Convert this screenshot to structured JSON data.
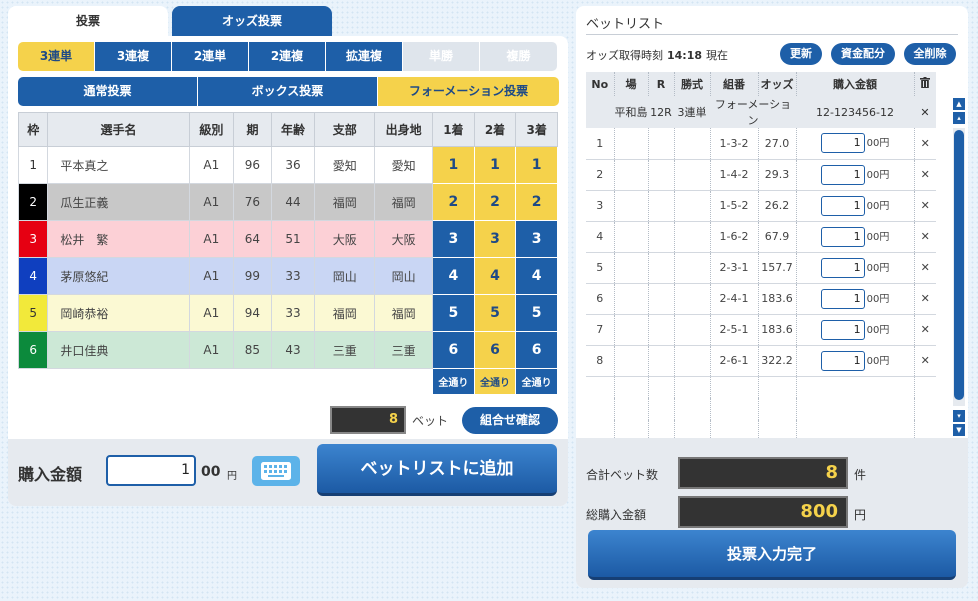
{
  "tabs": {
    "vote": "投票",
    "odds": "オッズ投票"
  },
  "bet_types": [
    {
      "label": "3連単",
      "state": "sel"
    },
    {
      "label": "3連複",
      "state": ""
    },
    {
      "label": "2連単",
      "state": ""
    },
    {
      "label": "2連複",
      "state": ""
    },
    {
      "label": "拡連複",
      "state": ""
    },
    {
      "label": "単勝",
      "state": "dis"
    },
    {
      "label": "複勝",
      "state": "dis"
    }
  ],
  "vote_modes": [
    {
      "label": "通常投票",
      "state": ""
    },
    {
      "label": "ボックス投票",
      "state": ""
    },
    {
      "label": "フォーメーション投票",
      "state": "sel"
    }
  ],
  "racer_table": {
    "headers": [
      "枠",
      "選手名",
      "級別",
      "期",
      "年齢",
      "支部",
      "出身地",
      "1着",
      "2着",
      "3着"
    ],
    "rows": [
      {
        "frame": "1",
        "name": "平本真之",
        "cls": "A1",
        "term": "96",
        "age": "36",
        "branch": "愛知",
        "birth": "愛知",
        "p1": "1",
        "p2": "1",
        "p3": "1",
        "s1": true,
        "s2": true,
        "s3": true
      },
      {
        "frame": "2",
        "name": "瓜生正義",
        "cls": "A1",
        "term": "76",
        "age": "44",
        "branch": "福岡",
        "birth": "福岡",
        "p1": "2",
        "p2": "2",
        "p3": "2",
        "s1": true,
        "s2": true,
        "s3": true
      },
      {
        "frame": "3",
        "name": "松井　繁",
        "cls": "A1",
        "term": "64",
        "age": "51",
        "branch": "大阪",
        "birth": "大阪",
        "p1": "3",
        "p2": "3",
        "p3": "3",
        "s1": false,
        "s2": true,
        "s3": false
      },
      {
        "frame": "4",
        "name": "茅原悠紀",
        "cls": "A1",
        "term": "99",
        "age": "33",
        "branch": "岡山",
        "birth": "岡山",
        "p1": "4",
        "p2": "4",
        "p3": "4",
        "s1": false,
        "s2": true,
        "s3": false
      },
      {
        "frame": "5",
        "name": "岡崎恭裕",
        "cls": "A1",
        "term": "94",
        "age": "33",
        "branch": "福岡",
        "birth": "福岡",
        "p1": "5",
        "p2": "5",
        "p3": "5",
        "s1": false,
        "s2": true,
        "s3": false
      },
      {
        "frame": "6",
        "name": "井口佳典",
        "cls": "A1",
        "term": "85",
        "age": "43",
        "branch": "三重",
        "birth": "三重",
        "p1": "6",
        "p2": "6",
        "p3": "6",
        "s1": false,
        "s2": true,
        "s3": false
      }
    ],
    "all_label": "全通り",
    "all_sel": [
      false,
      true,
      false
    ]
  },
  "bet_count": "8",
  "bet_unit": "ベット",
  "confirm_label": "組合せ確認",
  "purchase": {
    "label": "購入金額",
    "value": "1",
    "unit": "00",
    "yen": "円",
    "add_label": "ベットリストに追加"
  },
  "betlist": {
    "title": "ベットリスト",
    "odds_label": "オッズ取得時刻",
    "odds_time": "14:18",
    "odds_now": "現在",
    "update_label": "更新",
    "fund_label": "資金配分",
    "delete_all_label": "全削除",
    "headers": [
      "No",
      "場",
      "R",
      "勝式",
      "組番",
      "オッズ",
      "購入金額"
    ],
    "group": {
      "venue": "平和島",
      "race": "12R",
      "type": "3連単",
      "combo": "フォーメーション",
      "amount": "12-123456-12"
    },
    "rows": [
      {
        "no": "1",
        "combo": "1-3-2",
        "odds": "27.0",
        "amount": "1"
      },
      {
        "no": "2",
        "combo": "1-4-2",
        "odds": "29.3",
        "amount": "1"
      },
      {
        "no": "3",
        "combo": "1-5-2",
        "odds": "26.2",
        "amount": "1"
      },
      {
        "no": "4",
        "combo": "1-6-2",
        "odds": "67.9",
        "amount": "1"
      },
      {
        "no": "5",
        "combo": "2-3-1",
        "odds": "157.7",
        "amount": "1"
      },
      {
        "no": "6",
        "combo": "2-4-1",
        "odds": "183.6",
        "amount": "1"
      },
      {
        "no": "7",
        "combo": "2-5-1",
        "odds": "183.6",
        "amount": "1"
      },
      {
        "no": "8",
        "combo": "2-6-1",
        "odds": "322.2",
        "amount": "1"
      }
    ],
    "unit": "00円"
  },
  "totals": {
    "count_label": "合計ベット数",
    "count_value": "8",
    "count_unit": "件",
    "amount_label": "総購入金額",
    "amount_value": "800",
    "amount_unit": "円",
    "done_label": "投票入力完了"
  }
}
